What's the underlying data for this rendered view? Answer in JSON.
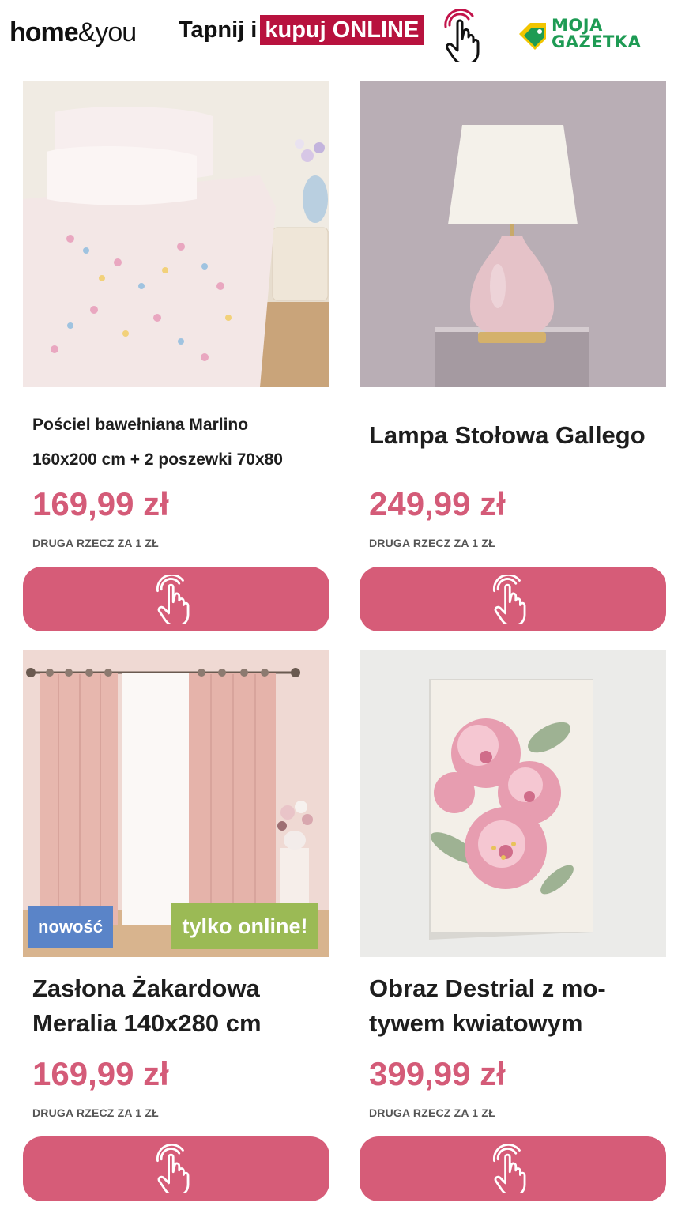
{
  "header": {
    "brand_bold": "home",
    "brand_rest": "&you",
    "tagline_prefix": "Tapnij i",
    "tagline_highlight": "kupuj ONLINE",
    "partner_line1": "MOJA",
    "partner_line2": "GAZETKA",
    "icons": [
      "tap-hand-icon",
      "price-tag-icon"
    ]
  },
  "colors": {
    "accent_pink": "#d65c78",
    "price_pink": "#d45b78",
    "highlight_red": "#b8123e",
    "badge_blue": "#5a84c8",
    "badge_green": "#9bba55",
    "gazetka_green": "#1e9b54"
  },
  "products": [
    {
      "title_line1": "Pościel bawełniana Marlino",
      "title_line2": "160x200 cm + 2 poszewki 70x80",
      "price": "169,99 zł",
      "promo": "DRUGA RZECZ ZA 1 ZŁ",
      "button_icon": "tap-hand-icon"
    },
    {
      "title_line1": "Lampa Stołowa Gallego",
      "title_line2": "",
      "price": "249,99 zł",
      "promo": "DRUGA RZECZ ZA 1 ZŁ",
      "button_icon": "tap-hand-icon"
    },
    {
      "title_line1": "Zasłona Żakardowa",
      "title_line2": "Meralia 140x280 cm",
      "price": "169,99 zł",
      "promo": "DRUGA RZECZ ZA 1 ZŁ",
      "badges": [
        "nowość",
        "tylko online!"
      ],
      "button_icon": "tap-hand-icon"
    },
    {
      "title_line1": "Obraz Destrial z mo-",
      "title_line2": "tywem kwiatowym",
      "price": "399,99 zł",
      "promo": "DRUGA RZECZ ZA 1 ZŁ",
      "button_icon": "tap-hand-icon"
    }
  ]
}
